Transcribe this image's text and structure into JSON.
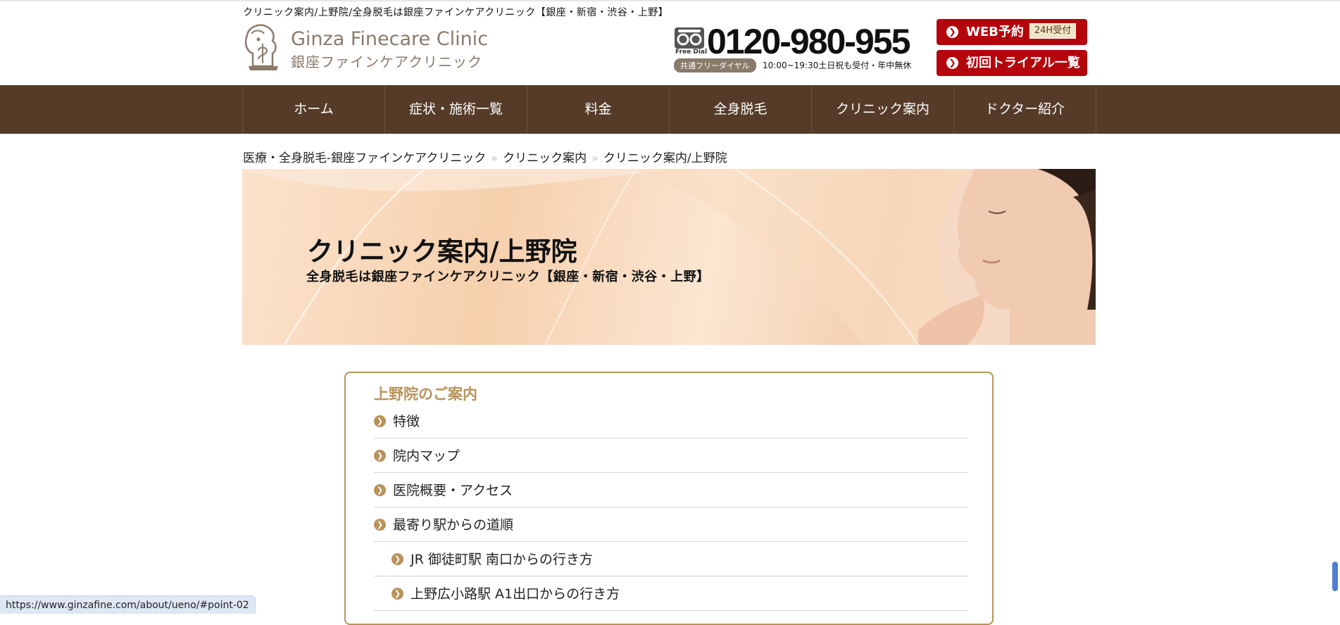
{
  "header": {
    "tagline": "クリニック案内/上野院/全身脱毛は銀座ファインケアクリニック【銀座・新宿・渋谷・上野】",
    "logo_en": "Ginza Finecare Clinic",
    "logo_ja": "銀座ファインケアクリニック",
    "free_dial_label": "Free Dial",
    "phone_number": "0120-980-955",
    "phone_badge": "共通フリーダイヤル",
    "phone_hours": "10:00~19:30土日祝も受付・年中無休",
    "web_reserve_label": "WEB予約",
    "web_reserve_tag": "24H受付",
    "trial_label": "初回トライアル一覧"
  },
  "nav": {
    "items": [
      {
        "label": "ホーム"
      },
      {
        "label": "症状・施術一覧"
      },
      {
        "label": "料金"
      },
      {
        "label": "全身脱毛"
      },
      {
        "label": "クリニック案内"
      },
      {
        "label": "ドクター紹介"
      }
    ]
  },
  "breadcrumb": {
    "separator": "»",
    "items": [
      {
        "label": "医療・全身脱毛-銀座ファインケアクリニック"
      },
      {
        "label": "クリニック案内"
      },
      {
        "label": "クリニック案内/上野院"
      }
    ]
  },
  "hero": {
    "title": "クリニック案内/上野院",
    "subtitle": "全身脱毛は銀座ファインケアクリニック【銀座・新宿・渋谷・上野】"
  },
  "toc": {
    "title": "上野院のご案内",
    "items": [
      {
        "label": "特徴"
      },
      {
        "label": "院内マップ"
      },
      {
        "label": "医院概要・アクセス"
      },
      {
        "label": "最寄り駅からの道順"
      },
      {
        "label": "JR 御徒町駅 南口からの行き方"
      },
      {
        "label": "上野広小路駅 A1出口からの行き方"
      }
    ]
  },
  "status": {
    "url": "https://www.ginzafine.com/about/ueno/#point-02"
  },
  "colors": {
    "nav_bg": "#553b28",
    "cta_red": "#b5050c",
    "accent_gold": "#b8935a",
    "logo_brown": "#8a7a6a"
  },
  "icons": {
    "logo_mark": "lion-crest-icon",
    "free_dial": "free-dial-icon",
    "button_arrow": "chevron-right-circle-icon",
    "toc_arrow": "chevron-right-circle-icon"
  }
}
